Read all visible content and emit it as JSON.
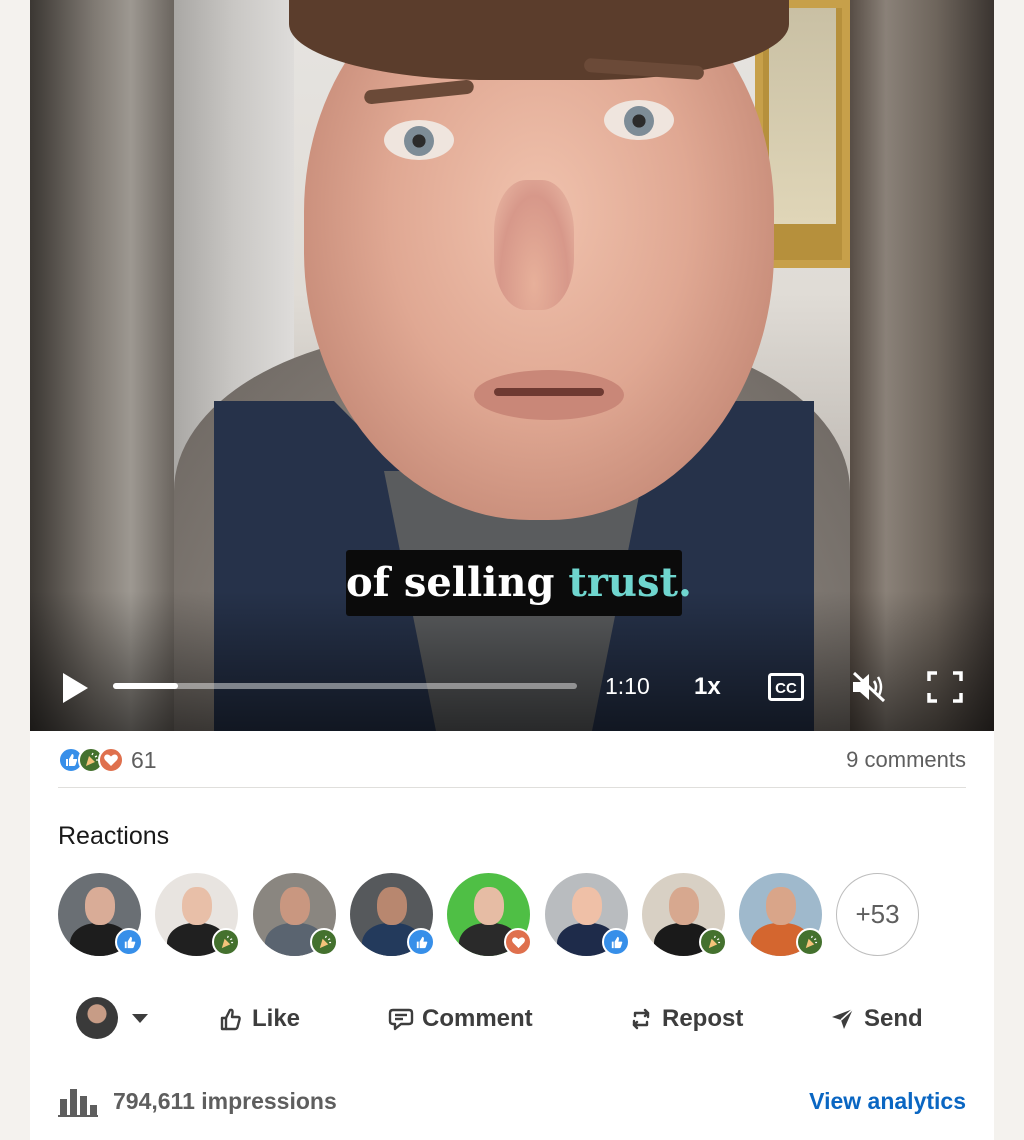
{
  "video": {
    "caption_prefix": "of selling ",
    "caption_highlight": "trust.",
    "time_remaining": "1:10",
    "playback_speed": "1x",
    "progress_fraction": 0.14
  },
  "social": {
    "reaction_count": "61",
    "comments_label": "9 comments",
    "reaction_types": [
      "like",
      "celebrate",
      "love"
    ]
  },
  "reactions_panel": {
    "title": "Reactions",
    "reactors": [
      {
        "reaction": "like"
      },
      {
        "reaction": "celebrate"
      },
      {
        "reaction": "celebrate"
      },
      {
        "reaction": "like"
      },
      {
        "reaction": "love"
      },
      {
        "reaction": "like"
      },
      {
        "reaction": "celebrate"
      },
      {
        "reaction": "celebrate"
      }
    ],
    "more_label": "+53"
  },
  "actions": {
    "like_label": "Like",
    "comment_label": "Comment",
    "repost_label": "Repost",
    "send_label": "Send"
  },
  "footer": {
    "impressions_label": "794,611 impressions",
    "analytics_label": "View analytics"
  },
  "colors": {
    "link_blue": "#0a66c2",
    "like_blue": "#378fe9",
    "celebrate_green": "#44712e",
    "love_orange": "#df704d",
    "caption_highlight": "#6fd6cf"
  }
}
